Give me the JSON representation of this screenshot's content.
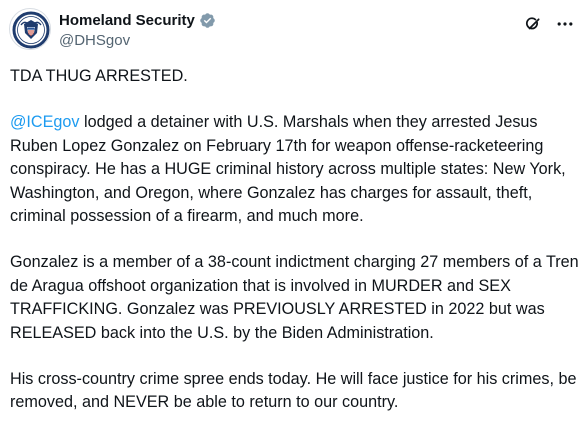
{
  "account": {
    "display_name": "Homeland Security",
    "handle": "@DHSgov",
    "verified_badge_icon": "verified-gray-badge-icon",
    "badge_color": "#829aab"
  },
  "actions": {
    "grok_icon": "grok-icon",
    "more_icon": "more-options-icon"
  },
  "post": {
    "line1": "TDA THUG ARRESTED.",
    "p2_mention": "@ICEgov",
    "p2_rest": " lodged a detainer with U.S. Marshals when they arrested Jesus Ruben Lopez Gonzalez on February 17th for weapon offense-racketeering conspiracy. He has a HUGE criminal history across multiple states: New York, Washington, and Oregon, where Gonzalez has charges for assault, theft, criminal possession of a firearm, and much more.",
    "p3": "Gonzalez is a member of a 38-count indictment charging 27 members of a Tren de Aragua offshoot organization that is involved in MURDER and SEX TRAFFICKING. Gonzalez was PREVIOUSLY ARRESTED in 2022 but was RELEASED back into the U.S. by the Biden Administration.",
    "p4": "His cross-country crime spree ends today. He will face justice for his crimes, be removed, and NEVER be able to return to our country."
  },
  "colors": {
    "text": "#0f1419",
    "secondary": "#536471",
    "link": "#1d9bf0"
  }
}
